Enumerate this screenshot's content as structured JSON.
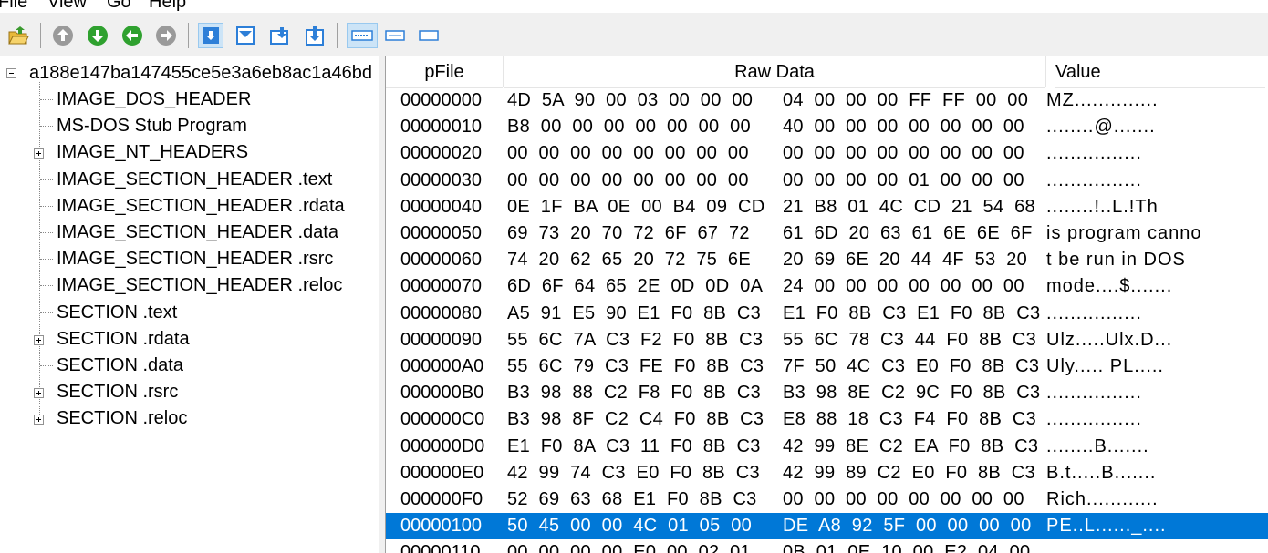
{
  "menu": [
    "File",
    "View",
    "Go",
    "Help"
  ],
  "toolbar": {
    "buttons": [
      "open-icon",
      "up-icon",
      "down-icon",
      "back-icon",
      "forward-icon",
      "view-a-icon",
      "view-b-icon",
      "view-c-icon",
      "view-d-icon",
      "layout-wide-icon",
      "layout-medium-icon",
      "layout-small-icon"
    ]
  },
  "tree": {
    "root": "a188e147ba147455ce5e3a6eb8ac1a46bd",
    "items": [
      {
        "label": "IMAGE_DOS_HEADER",
        "expandable": false
      },
      {
        "label": "MS-DOS Stub Program",
        "expandable": false
      },
      {
        "label": "IMAGE_NT_HEADERS",
        "expandable": true
      },
      {
        "label": "IMAGE_SECTION_HEADER .text",
        "expandable": false
      },
      {
        "label": "IMAGE_SECTION_HEADER .rdata",
        "expandable": false
      },
      {
        "label": "IMAGE_SECTION_HEADER .data",
        "expandable": false
      },
      {
        "label": "IMAGE_SECTION_HEADER .rsrc",
        "expandable": false
      },
      {
        "label": "IMAGE_SECTION_HEADER .reloc",
        "expandable": false
      },
      {
        "label": "SECTION .text",
        "expandable": false
      },
      {
        "label": "SECTION .rdata",
        "expandable": true
      },
      {
        "label": "SECTION .data",
        "expandable": false
      },
      {
        "label": "SECTION .rsrc",
        "expandable": true
      },
      {
        "label": "SECTION .reloc",
        "expandable": true
      }
    ]
  },
  "hex": {
    "columns": {
      "offset": "pFile",
      "raw": "Raw Data",
      "value": "Value"
    },
    "selected_index": 16,
    "rows": [
      {
        "offset": "00000000",
        "b1": "4D  5A  90  00  03  00  00  00",
        "b2": "04  00  00  00  FF  FF  00  00",
        "value": "MZ.............."
      },
      {
        "offset": "00000010",
        "b1": "B8  00  00  00  00  00  00  00",
        "b2": "40  00  00  00  00  00  00  00",
        "value": "........@......."
      },
      {
        "offset": "00000020",
        "b1": "00  00  00  00  00  00  00  00",
        "b2": "00  00  00  00  00  00  00  00",
        "value": "................"
      },
      {
        "offset": "00000030",
        "b1": "00  00  00  00  00  00  00  00",
        "b2": "00  00  00  00  01  00  00  00",
        "value": "................"
      },
      {
        "offset": "00000040",
        "b1": "0E  1F  BA  0E  00  B4  09  CD",
        "b2": "21  B8  01  4C  CD  21  54  68",
        "value": "........!..L.!Th"
      },
      {
        "offset": "00000050",
        "b1": "69  73  20  70  72  6F  67  72",
        "b2": "61  6D  20  63  61  6E  6E  6F",
        "value": "is program canno"
      },
      {
        "offset": "00000060",
        "b1": "74  20  62  65  20  72  75  6E",
        "b2": "20  69  6E  20  44  4F  53  20",
        "value": "t be run in DOS "
      },
      {
        "offset": "00000070",
        "b1": "6D  6F  64  65  2E  0D  0D  0A",
        "b2": "24  00  00  00  00  00  00  00",
        "value": "mode....$......."
      },
      {
        "offset": "00000080",
        "b1": "A5  91  E5  90  E1  F0  8B  C3",
        "b2": "E1  F0  8B  C3  E1  F0  8B  C3",
        "value": "................"
      },
      {
        "offset": "00000090",
        "b1": "55  6C  7A  C3  F2  F0  8B  C3",
        "b2": "55  6C  78  C3  44  F0  8B  C3",
        "value": "Ulz.....Ulx.D..."
      },
      {
        "offset": "000000A0",
        "b1": "55  6C  79  C3  FE  F0  8B  C3",
        "b2": "7F  50  4C  C3  E0  F0  8B  C3",
        "value": "Uly..... PL....."
      },
      {
        "offset": "000000B0",
        "b1": "B3  98  88  C2  F8  F0  8B  C3",
        "b2": "B3  98  8E  C2  9C  F0  8B  C3",
        "value": "................"
      },
      {
        "offset": "000000C0",
        "b1": "B3  98  8F  C2  C4  F0  8B  C3",
        "b2": "E8  88  18  C3  F4  F0  8B  C3",
        "value": "................"
      },
      {
        "offset": "000000D0",
        "b1": "E1  F0  8A  C3  11  F0  8B  C3",
        "b2": "42  99  8E  C2  EA  F0  8B  C3",
        "value": "........B......."
      },
      {
        "offset": "000000E0",
        "b1": "42  99  74  C3  E0  F0  8B  C3",
        "b2": "42  99  89  C2  E0  F0  8B  C3",
        "value": "B.t.....B......."
      },
      {
        "offset": "000000F0",
        "b1": "52  69  63  68  E1  F0  8B  C3",
        "b2": "00  00  00  00  00  00  00  00",
        "value": "Rich............"
      },
      {
        "offset": "00000100",
        "b1": "50  45  00  00  4C  01  05  00",
        "b2": "DE  A8  92  5F  00  00  00  00",
        "value": "PE..L......_...."
      },
      {
        "offset": "00000110",
        "b1": "00  00  00  00  E0  00  02  01",
        "b2": "0B  01  0E  10  00  E2  04  00",
        "value": ""
      }
    ]
  }
}
